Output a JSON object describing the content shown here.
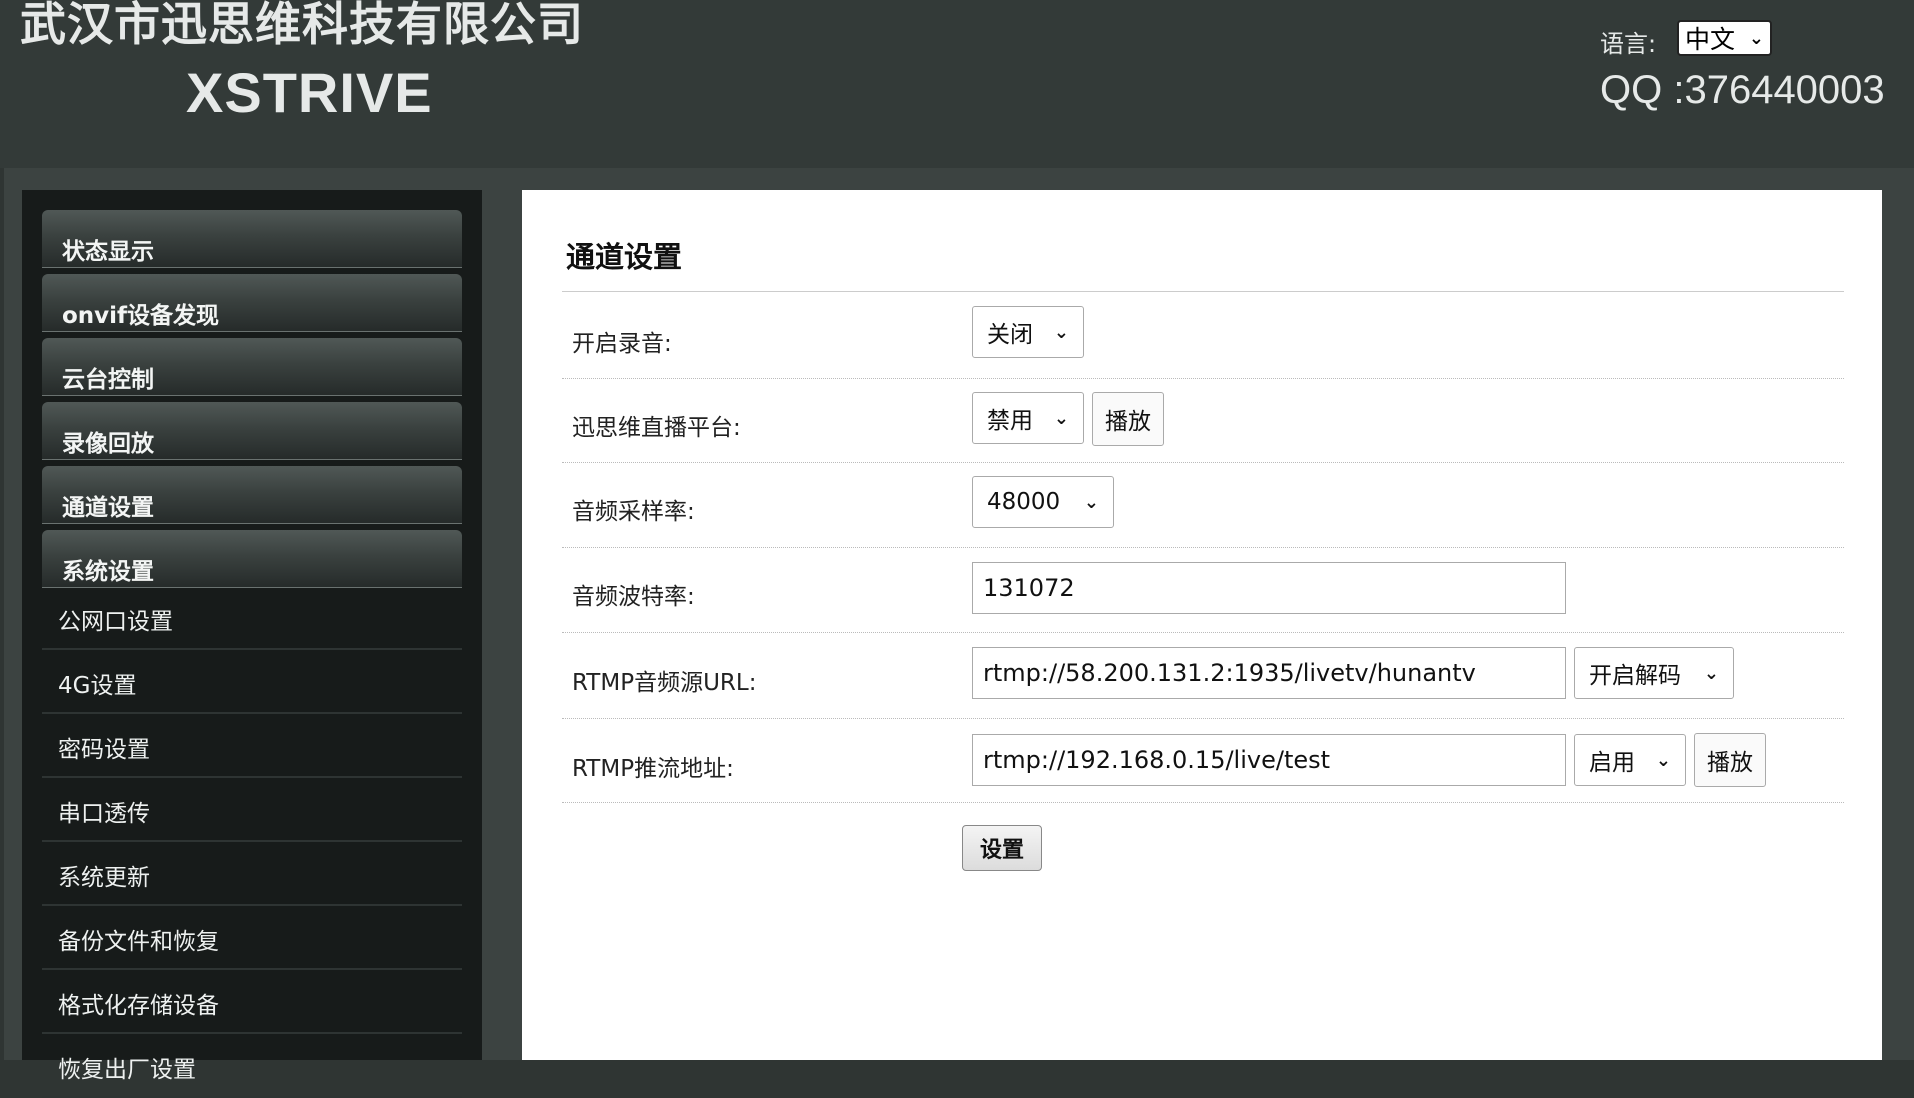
{
  "header": {
    "company": "武汉市迅思维科技有限公司",
    "brand": "XSTRIVE",
    "language_label": "语言:",
    "language_selected": "中文",
    "qq": "QQ :376440003"
  },
  "sidebar": {
    "menu": [
      "状态显示",
      "onvif设备发现",
      "云台控制",
      "录像回放",
      "通道设置",
      "系统设置"
    ],
    "submenu": [
      "公网口设置",
      "4G设置",
      "密码设置",
      "串口透传",
      "系统更新",
      "备份文件和恢复",
      "格式化存储设备",
      "恢复出厂设置"
    ]
  },
  "main": {
    "title": "通道设置",
    "rows": {
      "record": {
        "label": "开启录音:",
        "select": "关闭"
      },
      "live": {
        "label": "迅思维直播平台:",
        "select": "禁用",
        "button": "播放"
      },
      "sample_rate": {
        "label": "音频采样率:",
        "select": "48000"
      },
      "bitrate": {
        "label": "音频波特率:",
        "value": "131072"
      },
      "rtmp_audio": {
        "label": "RTMP音频源URL:",
        "value": "rtmp://58.200.131.2:1935/livetv/hunantv",
        "select": "开启解码"
      },
      "rtmp_push": {
        "label": "RTMP推流地址:",
        "value": "rtmp://192.168.0.15/live/test",
        "select": "启用",
        "button": "播放"
      }
    },
    "submit_label": "设置"
  }
}
